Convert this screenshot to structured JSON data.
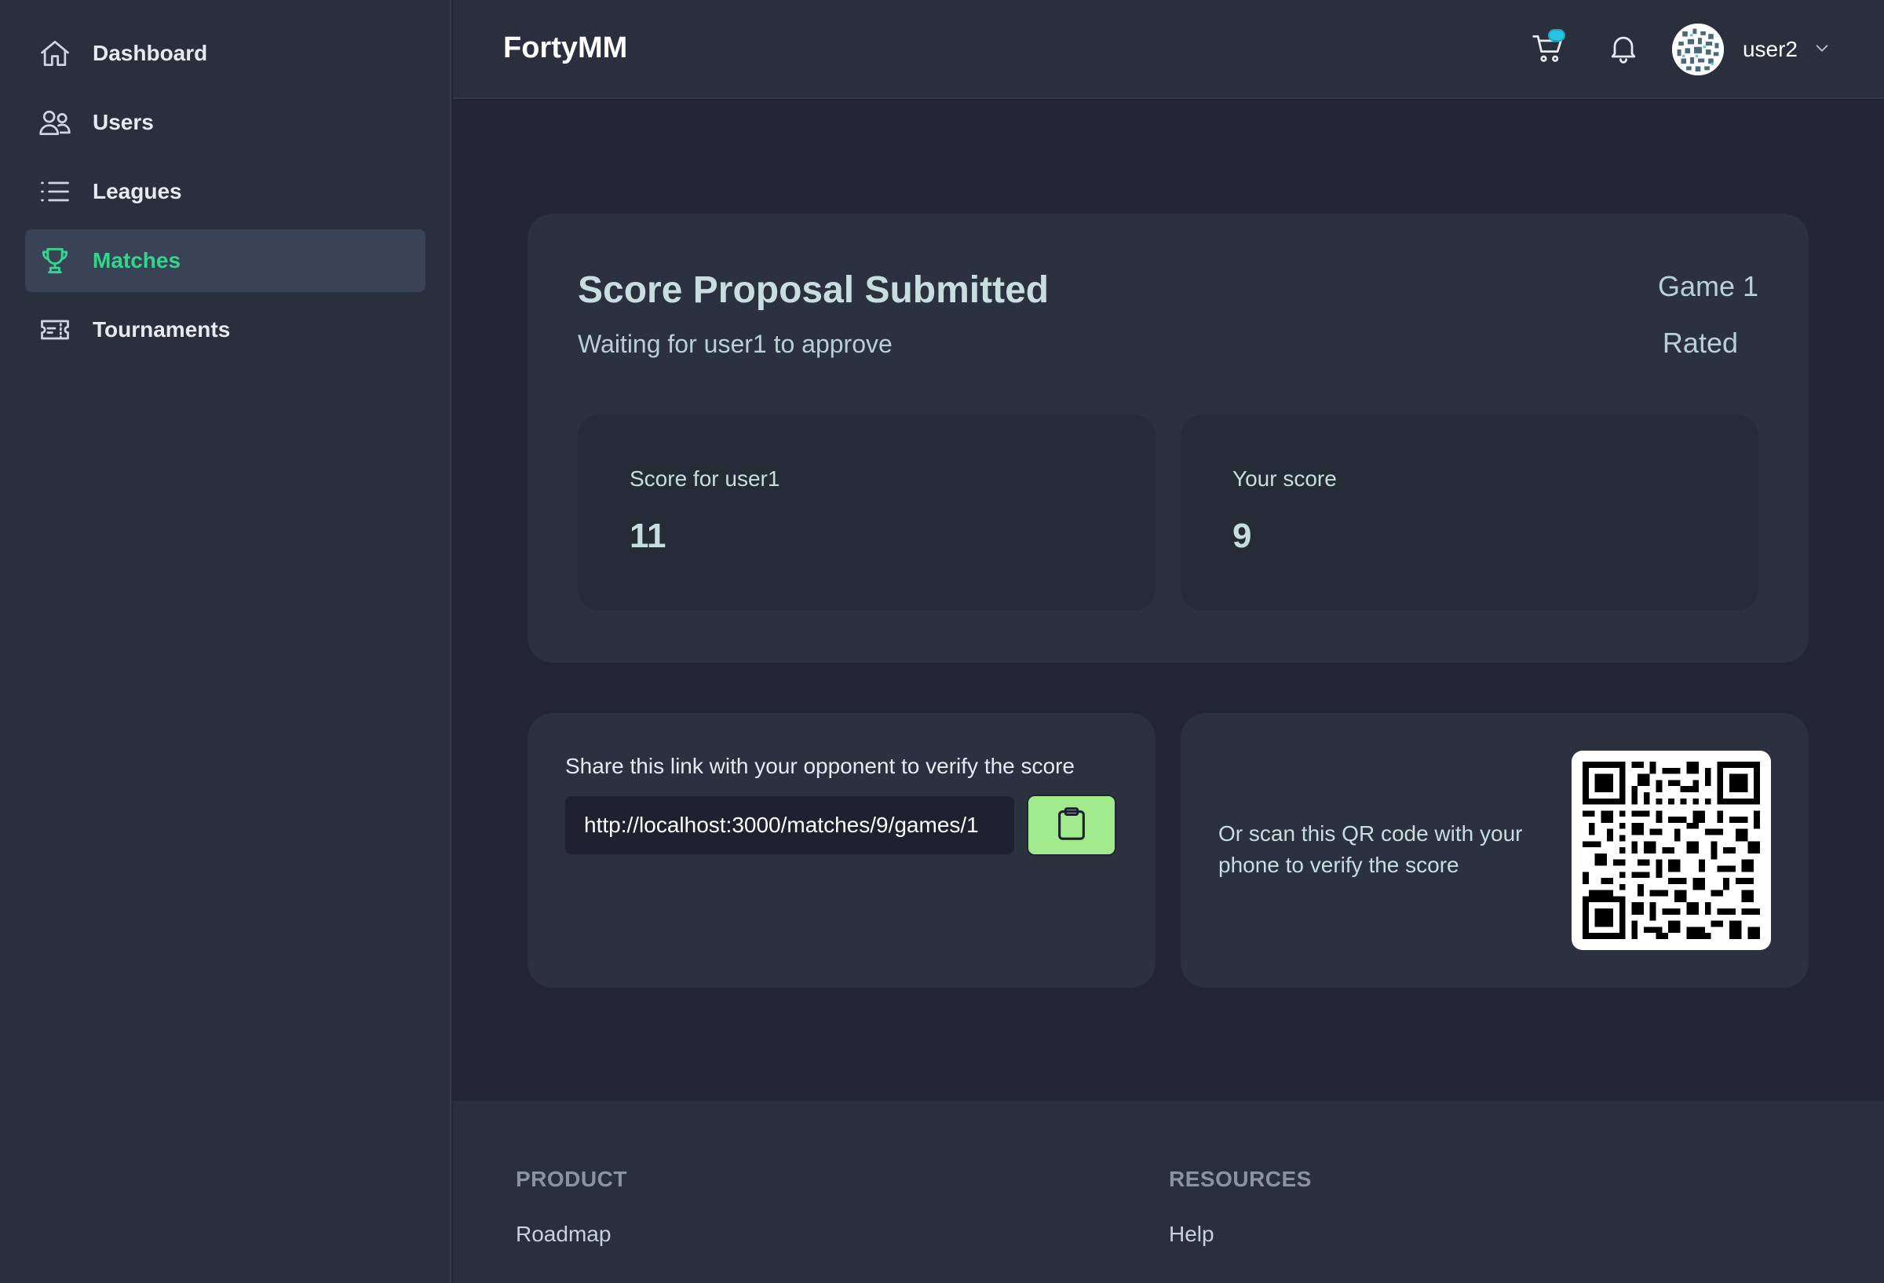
{
  "sidebar": {
    "items": [
      {
        "label": "Dashboard",
        "icon": "home-icon"
      },
      {
        "label": "Users",
        "icon": "users-icon"
      },
      {
        "label": "Leagues",
        "icon": "list-icon"
      },
      {
        "label": "Matches",
        "icon": "trophy-icon",
        "active": true
      },
      {
        "label": "Tournaments",
        "icon": "ticket-icon"
      }
    ]
  },
  "header": {
    "brand": "FortyMM",
    "username": "user2"
  },
  "proposal": {
    "title": "Score Proposal Submitted",
    "subtitle": "Waiting for user1 to approve",
    "game": "Game 1",
    "rated": "Rated",
    "opponent_score_label": "Score for user1",
    "opponent_score": "11",
    "your_score_label": "Your score",
    "your_score": "9"
  },
  "share": {
    "text": "Share this link with your opponent to verify the score",
    "link": "http://localhost:3000/matches/9/games/1"
  },
  "qr": {
    "text": "Or scan this QR code with your phone to verify the score"
  },
  "footer": {
    "product_heading": "PRODUCT",
    "product_links": [
      "Roadmap"
    ],
    "resources_heading": "RESOURCES",
    "resources_links": [
      "Help"
    ]
  },
  "colors": {
    "accent": "#35d48e",
    "copy_button": "#a2ea8e",
    "badge": "#28c3e0",
    "background": "#222632",
    "panel": "#2a2f3d"
  }
}
